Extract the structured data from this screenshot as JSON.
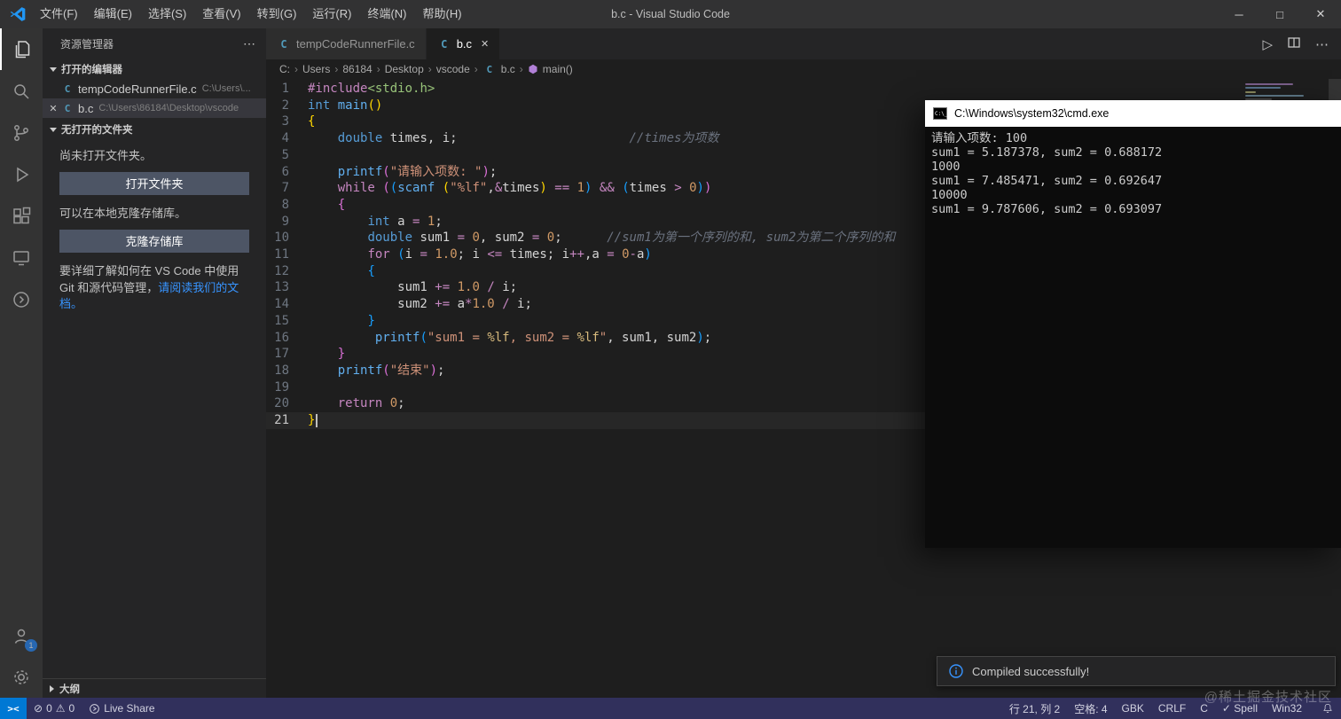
{
  "titlebar": {
    "menus": [
      "文件(F)",
      "编辑(E)",
      "选择(S)",
      "查看(V)",
      "转到(G)",
      "运行(R)",
      "终端(N)",
      "帮助(H)"
    ],
    "title": "b.c - Visual Studio Code"
  },
  "icons": {
    "min": "─",
    "max": "□",
    "close": "✕",
    "more": "⋯",
    "run": "▷",
    "breadcrumb_sep": "›",
    "c_letter": "C",
    "error": "⊘",
    "warning": "⚠",
    "remote": "><"
  },
  "activitybar": {
    "account_badge": "1"
  },
  "sidebar": {
    "title": "资源管理器",
    "open_editors": {
      "header": "打开的编辑器",
      "items": [
        {
          "name": "tempCodeRunnerFile.c",
          "path": "C:\\Users\\...",
          "active": false,
          "closable": false
        },
        {
          "name": "b.c",
          "path": "C:\\Users\\86184\\Desktop\\vscode",
          "active": true,
          "closable": true
        }
      ]
    },
    "no_folder": {
      "header": "无打开的文件夹",
      "text1": "尚未打开文件夹。",
      "open_btn": "打开文件夹",
      "text2": "可以在本地克隆存储库。",
      "clone_btn": "克隆存储库",
      "text3": "要详细了解如何在 VS Code 中使用 Git 和源代码管理，",
      "text3_link": "请阅读我们的文档。"
    },
    "outline": "大纲"
  },
  "tabs": [
    {
      "label": "tempCodeRunnerFile.c",
      "active": false
    },
    {
      "label": "b.c",
      "active": true
    }
  ],
  "breadcrumb": [
    "C:",
    "Users",
    "86184",
    "Desktop",
    "vscode",
    "b.c",
    "main()"
  ],
  "editor": {
    "cursor_line": 21,
    "lines": [
      {
        "n": 1,
        "segs": [
          [
            "k",
            "#include"
          ],
          [
            "g",
            "<stdio.h>"
          ]
        ]
      },
      {
        "n": 2,
        "segs": [
          [
            "t",
            "int"
          ],
          [
            "p",
            " "
          ],
          [
            "f",
            "main"
          ],
          [
            "b1",
            "()"
          ]
        ]
      },
      {
        "n": 3,
        "segs": [
          [
            "b1",
            "{"
          ]
        ]
      },
      {
        "n": 4,
        "segs": [
          [
            "p",
            "    "
          ],
          [
            "t",
            "double"
          ],
          [
            "p",
            " times, i;"
          ],
          [
            "p",
            "                       "
          ],
          [
            "c",
            "//times为项数"
          ]
        ]
      },
      {
        "n": 5,
        "segs": []
      },
      {
        "n": 6,
        "segs": [
          [
            "p",
            "    "
          ],
          [
            "f",
            "printf"
          ],
          [
            "b2",
            "("
          ],
          [
            "s",
            "\"请输入项数: \""
          ],
          [
            "b2",
            ")"
          ],
          [
            "p",
            ";"
          ]
        ]
      },
      {
        "n": 7,
        "segs": [
          [
            "p",
            "    "
          ],
          [
            "k",
            "while"
          ],
          [
            "p",
            " "
          ],
          [
            "b2",
            "("
          ],
          [
            "b3",
            "("
          ],
          [
            "f",
            "scanf"
          ],
          [
            "p",
            " "
          ],
          [
            "b1",
            "("
          ],
          [
            "s",
            "\"%lf\""
          ],
          [
            "p",
            ","
          ],
          [
            "o",
            "&"
          ],
          [
            "p",
            "times"
          ],
          [
            "b1",
            ")"
          ],
          [
            "p",
            " "
          ],
          [
            "o",
            "=="
          ],
          [
            "p",
            " "
          ],
          [
            "n",
            "1"
          ],
          [
            "b3",
            ")"
          ],
          [
            "p",
            " "
          ],
          [
            "o",
            "&&"
          ],
          [
            "p",
            " "
          ],
          [
            "b3",
            "("
          ],
          [
            "p",
            "times "
          ],
          [
            "o",
            ">"
          ],
          [
            "p",
            " "
          ],
          [
            "n",
            "0"
          ],
          [
            "b3",
            ")"
          ],
          [
            "b2",
            ")"
          ]
        ]
      },
      {
        "n": 8,
        "segs": [
          [
            "p",
            "    "
          ],
          [
            "b2",
            "{"
          ]
        ]
      },
      {
        "n": 9,
        "segs": [
          [
            "p",
            "        "
          ],
          [
            "t",
            "int"
          ],
          [
            "p",
            " a "
          ],
          [
            "o",
            "="
          ],
          [
            "p",
            " "
          ],
          [
            "n",
            "1"
          ],
          [
            "p",
            ";"
          ]
        ]
      },
      {
        "n": 10,
        "segs": [
          [
            "p",
            "        "
          ],
          [
            "t",
            "double"
          ],
          [
            "p",
            " sum1 "
          ],
          [
            "o",
            "="
          ],
          [
            "p",
            " "
          ],
          [
            "n",
            "0"
          ],
          [
            "p",
            ", sum2 "
          ],
          [
            "o",
            "="
          ],
          [
            "p",
            " "
          ],
          [
            "n",
            "0"
          ],
          [
            "p",
            ";      "
          ],
          [
            "c",
            "//sum1为第一个序列的和, sum2为第二个序列的和"
          ]
        ]
      },
      {
        "n": 11,
        "segs": [
          [
            "p",
            "        "
          ],
          [
            "k",
            "for"
          ],
          [
            "p",
            " "
          ],
          [
            "b3",
            "("
          ],
          [
            "p",
            "i "
          ],
          [
            "o",
            "="
          ],
          [
            "p",
            " "
          ],
          [
            "n",
            "1.0"
          ],
          [
            "p",
            "; i "
          ],
          [
            "o",
            "<="
          ],
          [
            "p",
            " times; i"
          ],
          [
            "o",
            "++"
          ],
          [
            "p",
            ",a "
          ],
          [
            "o",
            "="
          ],
          [
            "p",
            " "
          ],
          [
            "n",
            "0"
          ],
          [
            "o",
            "-"
          ],
          [
            "p",
            "a"
          ],
          [
            "b3",
            ")"
          ]
        ]
      },
      {
        "n": 12,
        "segs": [
          [
            "p",
            "        "
          ],
          [
            "b3",
            "{"
          ]
        ]
      },
      {
        "n": 13,
        "segs": [
          [
            "p",
            "            sum1 "
          ],
          [
            "o",
            "+="
          ],
          [
            "p",
            " "
          ],
          [
            "n",
            "1.0"
          ],
          [
            "p",
            " "
          ],
          [
            "o",
            "/"
          ],
          [
            "p",
            " i;"
          ]
        ]
      },
      {
        "n": 14,
        "segs": [
          [
            "p",
            "            sum2 "
          ],
          [
            "o",
            "+="
          ],
          [
            "p",
            " a"
          ],
          [
            "o",
            "*"
          ],
          [
            "n",
            "1.0"
          ],
          [
            "p",
            " "
          ],
          [
            "o",
            "/"
          ],
          [
            "p",
            " i;"
          ]
        ]
      },
      {
        "n": 15,
        "segs": [
          [
            "p",
            "        "
          ],
          [
            "b3",
            "}"
          ]
        ]
      },
      {
        "n": 16,
        "segs": [
          [
            "p",
            "         "
          ],
          [
            "f",
            "printf"
          ],
          [
            "b3",
            "("
          ],
          [
            "s",
            "\"sum1 = "
          ],
          [
            "e",
            "%lf"
          ],
          [
            "s",
            ", sum2 = "
          ],
          [
            "e",
            "%lf"
          ],
          [
            "s",
            "\""
          ],
          [
            "p",
            ", sum1, sum2"
          ],
          [
            "b3",
            ")"
          ],
          [
            "p",
            ";"
          ]
        ]
      },
      {
        "n": 17,
        "segs": [
          [
            "p",
            "    "
          ],
          [
            "b2",
            "}"
          ]
        ]
      },
      {
        "n": 18,
        "segs": [
          [
            "p",
            "    "
          ],
          [
            "f",
            "printf"
          ],
          [
            "b2",
            "("
          ],
          [
            "s",
            "\"结束\""
          ],
          [
            "b2",
            ")"
          ],
          [
            "p",
            ";"
          ]
        ]
      },
      {
        "n": 19,
        "segs": []
      },
      {
        "n": 20,
        "segs": [
          [
            "p",
            "    "
          ],
          [
            "k",
            "return"
          ],
          [
            "p",
            " "
          ],
          [
            "n",
            "0"
          ],
          [
            "p",
            ";"
          ]
        ]
      },
      {
        "n": 21,
        "segs": [
          [
            "b1",
            "}"
          ]
        ]
      }
    ]
  },
  "cmd": {
    "title": "C:\\Windows\\system32\\cmd.exe",
    "lines": [
      "请输入项数: 100",
      "sum1 = 5.187378, sum2 = 0.688172",
      "1000",
      "sum1 = 7.485471, sum2 = 0.692647",
      "10000",
      "sum1 = 9.787606, sum2 = 0.693097"
    ]
  },
  "notification": {
    "text": "Compiled successfully!"
  },
  "watermark": "@稀土掘金技术社区",
  "statusbar": {
    "errors": "0",
    "warnings": "0",
    "live_share": "Live Share",
    "right": [
      "行 21, 列 2",
      "空格: 4",
      "GBK",
      "CRLF",
      "C",
      "✓ Spell",
      "Win32"
    ]
  }
}
